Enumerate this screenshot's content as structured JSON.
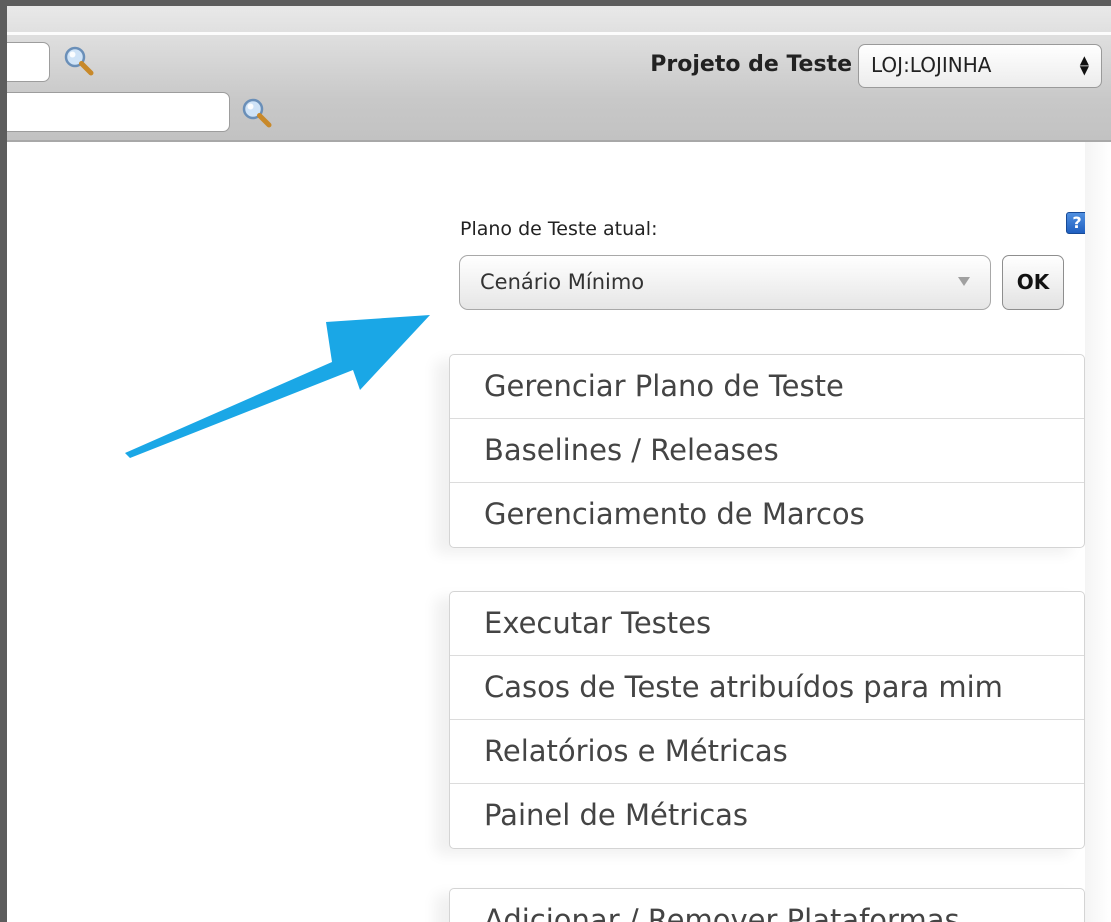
{
  "toolbar": {
    "search1_value": "",
    "search2_value": "",
    "project_label": "Projeto de Teste",
    "project_selected": "LOJ:LOJINHA"
  },
  "plan": {
    "label": "Plano de Teste atual:",
    "selected": "Cenário Mínimo",
    "ok_label": "OK",
    "help_label": "?"
  },
  "menu_group_1": [
    {
      "label": "Gerenciar Plano de Teste"
    },
    {
      "label": "Baselines / Releases"
    },
    {
      "label": "Gerenciamento de Marcos"
    }
  ],
  "menu_group_2": [
    {
      "label": "Executar Testes"
    },
    {
      "label": "Casos de Teste atribuídos para mim"
    },
    {
      "label": "Relatórios e Métricas"
    },
    {
      "label": "Painel de Métricas"
    }
  ],
  "menu_group_3": [
    {
      "label": "Adicionar / Remover Plataformas"
    }
  ],
  "colors": {
    "arrow": "#1aa7e6",
    "help_icon": "#2d6fd1"
  },
  "icons": {
    "search": "magnifier-icon",
    "help": "help-icon",
    "annotation": "arrow-annotation"
  }
}
